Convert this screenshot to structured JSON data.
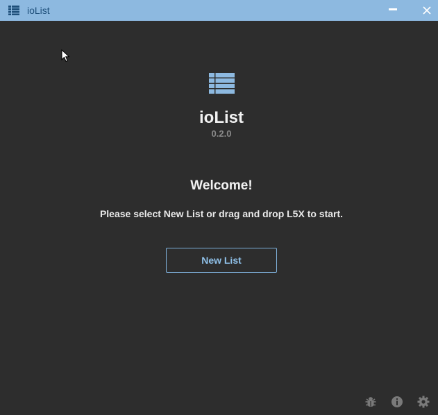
{
  "window": {
    "title": "ioList"
  },
  "app": {
    "name": "ioList",
    "version": "0.2.0"
  },
  "welcome": {
    "heading": "Welcome!",
    "instructions": "Please select New List or drag and drop L5X to start."
  },
  "actions": {
    "new_list_label": "New List"
  },
  "footer_icons": [
    "bug-icon",
    "info-icon",
    "gear-icon"
  ],
  "colors": {
    "titlebar": "#8db9e0",
    "background": "#2d2d2d",
    "accent": "#7fb2dc",
    "footer_icon": "#7a7a7a"
  }
}
